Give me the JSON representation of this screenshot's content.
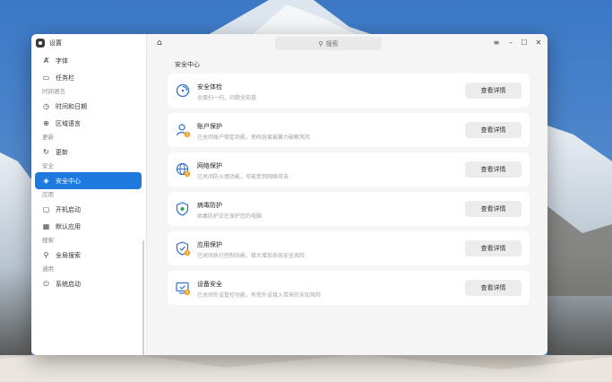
{
  "window": {
    "app_title": "设置"
  },
  "titlebar": {
    "search_placeholder": "搜索"
  },
  "sidebar": {
    "entries": [
      {
        "kind": "item",
        "label": "字体",
        "icon": "font-icon"
      },
      {
        "kind": "item",
        "label": "任务栏",
        "icon": "taskbar-icon"
      },
      {
        "kind": "group",
        "label": "时间语言"
      },
      {
        "kind": "item",
        "label": "时间和日期",
        "icon": "clock-icon"
      },
      {
        "kind": "item",
        "label": "区域语言",
        "icon": "globe-icon"
      },
      {
        "kind": "group",
        "label": "更新"
      },
      {
        "kind": "item",
        "label": "更新",
        "icon": "update-icon"
      },
      {
        "kind": "group",
        "label": "安全"
      },
      {
        "kind": "item",
        "label": "安全中心",
        "icon": "shield-icon",
        "active": true
      },
      {
        "kind": "group",
        "label": "应用"
      },
      {
        "kind": "item",
        "label": "开机启动",
        "icon": "startup-icon"
      },
      {
        "kind": "item",
        "label": "默认应用",
        "icon": "grid-icon"
      },
      {
        "kind": "group",
        "label": "搜索"
      },
      {
        "kind": "item",
        "label": "全局搜索",
        "icon": "search-icon"
      },
      {
        "kind": "group",
        "label": "通用"
      },
      {
        "kind": "item",
        "label": "系统启动",
        "icon": "power-icon"
      }
    ]
  },
  "main": {
    "section_title": "安全中心",
    "cards": [
      {
        "title": "安全体检",
        "desc": "全面扫一扫，问题全知道",
        "button": "查看详情",
        "icon": "scan-icon",
        "warn": false
      },
      {
        "title": "账户保护",
        "desc": "已关闭账户锁定功能，密码容易被暴力破解风险",
        "button": "查看详情",
        "icon": "account-icon",
        "warn": true
      },
      {
        "title": "网络保护",
        "desc": "已关闭防火墙功能，可能受到网络攻击",
        "button": "查看详情",
        "icon": "network-icon",
        "warn": true
      },
      {
        "title": "病毒防护",
        "desc": "病毒防护正在保护您的电脑",
        "button": "查看详情",
        "icon": "virus-shield-icon",
        "warn": false
      },
      {
        "title": "应用保护",
        "desc": "已关闭执行控制功能，极大增加系统安全风险",
        "button": "查看详情",
        "icon": "app-shield-icon",
        "warn": true
      },
      {
        "title": "设备安全",
        "desc": "已关闭外设管控功能，有受外设接入带来的未知风险",
        "button": "查看详情",
        "icon": "device-icon",
        "warn": true
      }
    ]
  },
  "colors": {
    "accent": "#1f7ae0",
    "warning": "#f0a020",
    "ok": "#2ea44f"
  }
}
